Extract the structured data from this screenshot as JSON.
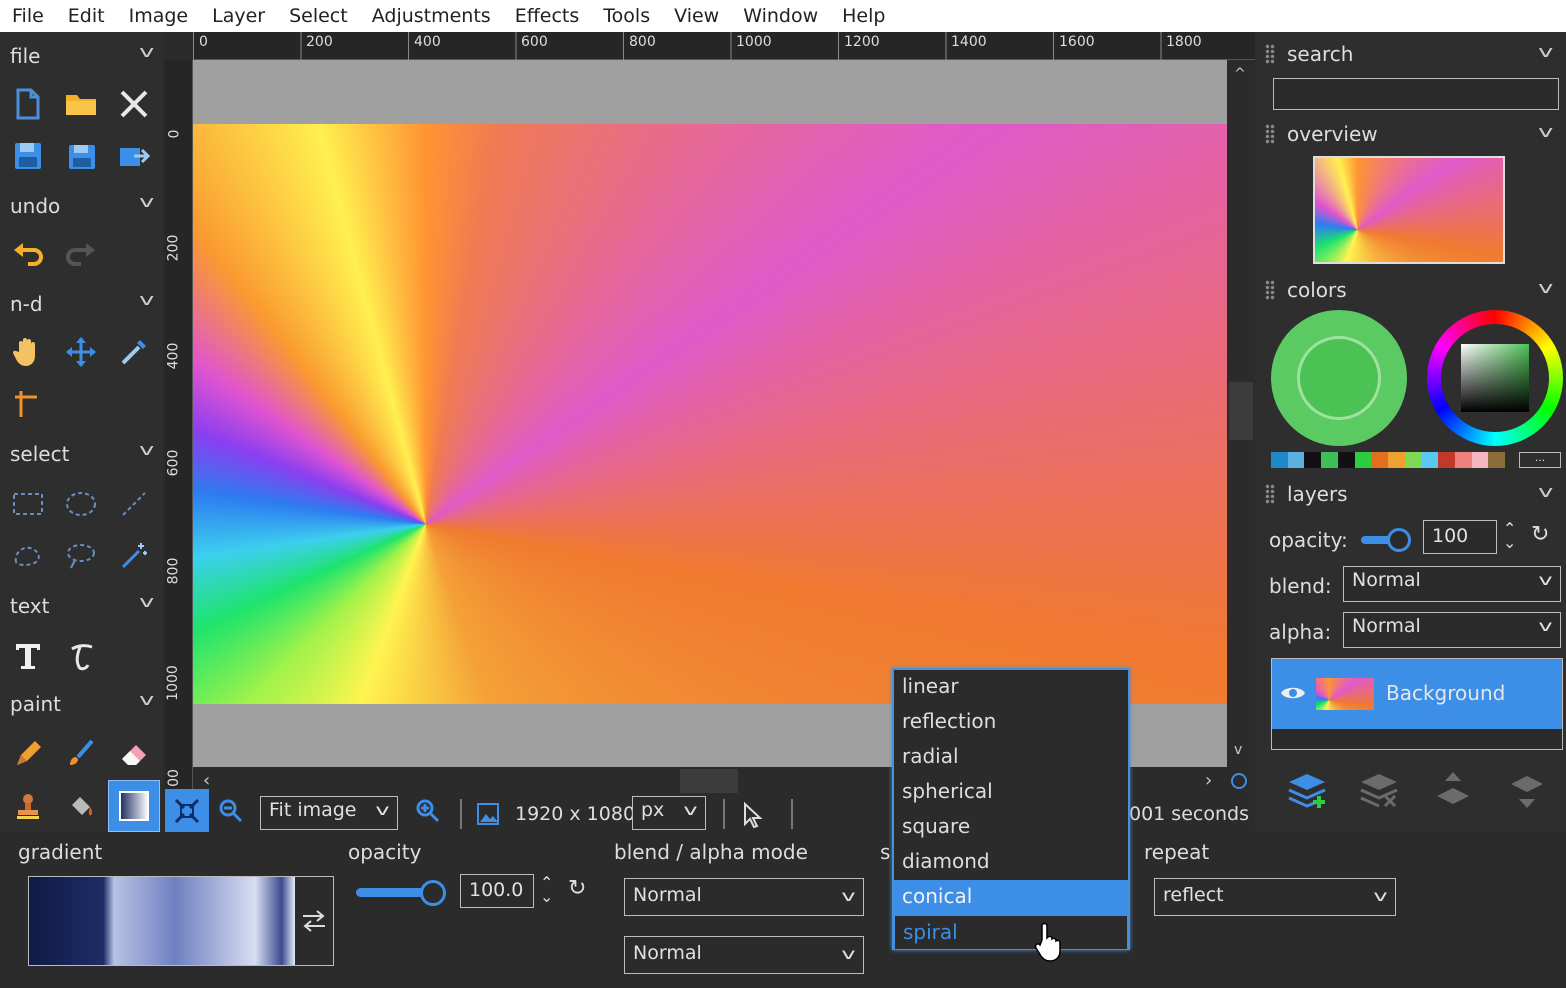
{
  "menu": [
    "File",
    "Edit",
    "Image",
    "Layer",
    "Select",
    "Adjustments",
    "Effects",
    "Tools",
    "View",
    "Window",
    "Help"
  ],
  "left_sections": {
    "file": "file",
    "undo": "undo",
    "nd": "n-d",
    "select": "select",
    "text": "text",
    "paint": "paint"
  },
  "ruler_top": [
    "0",
    "200",
    "400",
    "600",
    "800",
    "1000",
    "1200",
    "1400",
    "1600",
    "1800"
  ],
  "ruler_left": [
    "0",
    "200",
    "400",
    "600",
    "800",
    "1000",
    "00"
  ],
  "status": {
    "zoom_mode": "Fit image",
    "size": "1920 x 1080",
    "unit": "px",
    "timing": "001 seconds"
  },
  "right": {
    "search_title": "search",
    "search_value": "",
    "overview_title": "overview",
    "colors_title": "colors",
    "more_label": "...",
    "layers_title": "layers",
    "opacity_label": "opacity:",
    "opacity_value": "100",
    "blend_label": "blend:",
    "blend_value": "Normal",
    "alpha_label": "alpha:",
    "alpha_value": "Normal",
    "layer_name": "Background"
  },
  "palette": [
    "#1e88c8",
    "#5bb0e0",
    "#111111",
    "#3fbf5a",
    "#111111",
    "#2ecc40",
    "#e07020",
    "#f0a030",
    "#7ed957",
    "#5ac8f0",
    "#c0392b",
    "#f08080",
    "#f4b6c2",
    "#8a6d3b"
  ],
  "bottom": {
    "gradient_label": "gradient",
    "opacity_label": "opacity",
    "opacity_value": "100.0",
    "blend_label": "blend / alpha mode",
    "blend_value": "Normal",
    "alpha_value": "Normal",
    "style_label": "s",
    "repeat_label": "repeat",
    "repeat_value": "reflect"
  },
  "gradient_types": {
    "options": [
      "linear",
      "reflection",
      "radial",
      "spherical",
      "square",
      "diamond",
      "conical",
      "spiral"
    ],
    "selected": "conical",
    "hovered": "spiral"
  },
  "colors": {
    "accent": "#3d8ee6",
    "primary_color": "#4cc255",
    "layer_highlight": "#3d8ee6"
  }
}
